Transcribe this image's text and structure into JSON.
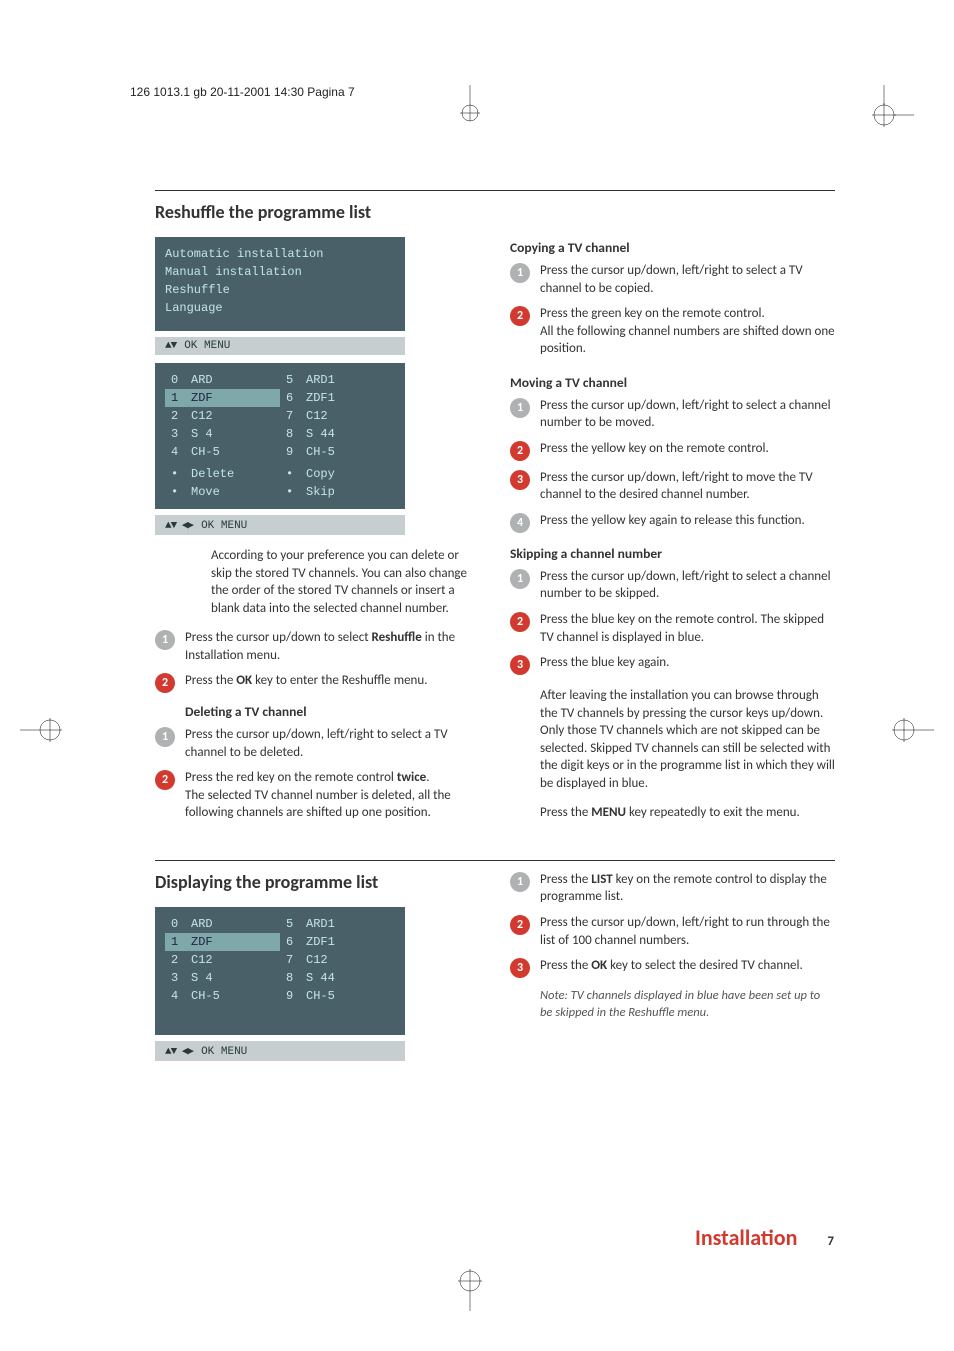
{
  "header_line": "126 1013.1 gb  20-11-2001  14:30  Pagina 7",
  "sec1": {
    "title": "Reshuffle the programme list",
    "intro": "According to your preference you can delete or skip the stored TV channels. You can also change the order of the stored TV channels or insert a blank data into the selected channel number.",
    "intro_steps": {
      "s1": "Press the cursor up/down to select ",
      "s1b": "Reshuffle",
      "s1c": " in the Installation menu.",
      "s2a": "Press the ",
      "s2b": "OK",
      "s2c": " key to enter the Reshuffle menu."
    },
    "deleting_title": "Deleting a TV channel",
    "deleting": {
      "s1": "Press the cursor up/down, left/right to select a TV channel to be deleted.",
      "s2a": "Press the red key on the remote control ",
      "s2b": "twice",
      "s2c": ".\nThe selected TV channel number is deleted, all the following channels are shifted up one position."
    },
    "copy_title": "Copying a TV channel",
    "copy": {
      "s1": "Press the cursor up/down, left/right to select a TV channel to be copied.",
      "s2": "Press the green key on the remote control.\nAll the following channel numbers are shifted down one position."
    },
    "move_title": "Moving a TV channel",
    "move": {
      "s1": "Press the cursor up/down, left/right to select a channel number to be moved.",
      "s2": "Press the yellow key on the remote control.",
      "s3": "Press the cursor up/down, left/right to move the TV channel to the desired channel number.",
      "s4": "Press the yellow key again to release this function."
    },
    "skip_title": "Skipping a channel number",
    "skip": {
      "s1": "Press the cursor up/down, left/right to select a channel number to be skipped.",
      "s2": "Press the blue key on the remote control. The skipped TV channel is displayed in blue.",
      "s3": "Press the blue key again.",
      "after": "After leaving the installation you can browse through the TV channels by pressing the cursor keys up/down. Only those TV channels which are not skipped can be selected. Skipped TV channels can still be selected with the digit keys or in the programme list in which they will be displayed in blue.",
      "exit_a": "Press the ",
      "exit_b": "MENU",
      "exit_c": " key repeatedly to exit the menu."
    }
  },
  "sec2": {
    "title": "Displaying the programme list",
    "steps": {
      "s1a": "Press the ",
      "s1b": "LIST",
      "s1c": " key on the remote control to display the programme list.",
      "s2": "Press the cursor up/down, left/right to run through the list of 100 channel numbers.",
      "s3a": "Press the ",
      "s3b": "OK",
      "s3c": " key to select the desired TV channel."
    },
    "note": "Note: TV channels displayed in blue have been set up to be skipped in the Reshuffle menu."
  },
  "osd_menu1": {
    "items": [
      "Automatic installation",
      "Manual installation",
      "Reshuffle",
      "Language"
    ],
    "footer": "OK MENU",
    "footer_sym": "▲▼"
  },
  "osd_menu2": {
    "left": [
      {
        "n": "0",
        "name": "ARD"
      },
      {
        "n": "1",
        "name": "ZDF",
        "sel": true
      },
      {
        "n": "2",
        "name": "C12"
      },
      {
        "n": "3",
        "name": "S 4"
      },
      {
        "n": "4",
        "name": "CH-5"
      }
    ],
    "right": [
      {
        "n": "5",
        "name": "ARD1"
      },
      {
        "n": "6",
        "name": "ZDF1"
      },
      {
        "n": "7",
        "name": "C12"
      },
      {
        "n": "8",
        "name": "S 44"
      },
      {
        "n": "9",
        "name": "CH-5"
      }
    ],
    "controls": {
      "l1": "Delete",
      "r1": "Copy",
      "l2": "Move",
      "r2": "Skip"
    },
    "footer_sym": "▲▼ ◀▶",
    "footer": "OK MENU"
  },
  "osd_menu3": {
    "footer_sym": "▲▼  ◀▶",
    "footer": "OK MENU"
  },
  "footer": {
    "title": "Installation",
    "page": "7"
  }
}
